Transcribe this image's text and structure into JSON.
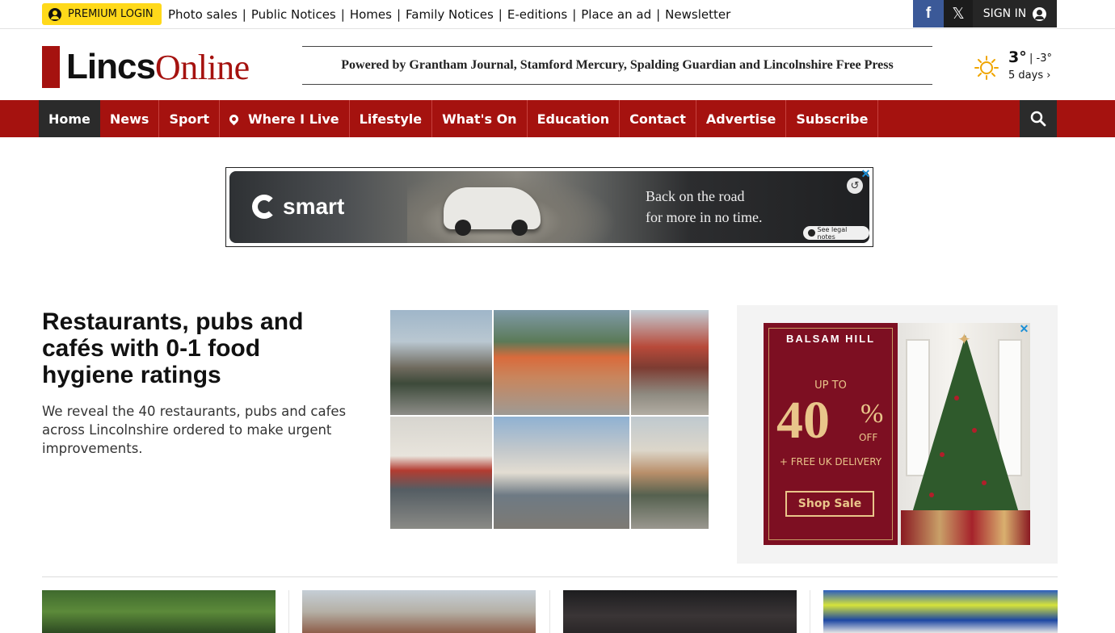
{
  "topbar": {
    "premium_label": "PREMIUM LOGIN",
    "links": [
      "Photo sales",
      "Public Notices",
      "Homes",
      "Family Notices",
      "E-editions",
      "Place an ad",
      "Newsletter"
    ],
    "facebook_glyph": "f",
    "x_glyph": "𝕏",
    "signin_label": "SIGN IN"
  },
  "masthead": {
    "logo_part1": "Lincs",
    "logo_part2": "Online",
    "powered_by": "Powered by Grantham Journal, Stamford Mercury, Spalding Guardian and Lincolnshire Free Press",
    "brand_color": "#a5120f"
  },
  "weather": {
    "temp_high": "3°",
    "temp_low": "| -3°",
    "forecast_link": "5 days ›",
    "icon": "sun-icon"
  },
  "nav": {
    "items": [
      "Home",
      "News",
      "Sport",
      "Where I Live",
      "Lifestyle",
      "What's On",
      "Education",
      "Contact",
      "Advertise",
      "Subscribe"
    ],
    "active": "Home"
  },
  "banner_ad": {
    "brand": "smart",
    "line1": "Back on the road",
    "line2": "for more in no time.",
    "legal": "See legal notes",
    "close_glyph": "✕",
    "replay_glyph": "↺"
  },
  "lead_story": {
    "headline": "Restaurants, pubs and cafés with 0-1 food hygiene ratings",
    "standfirst": "We reveal the 40 restaurants, pubs and cafes across Lincolnshire ordered to make urgent improvements."
  },
  "side_ad": {
    "brand": "BALSAM HILL",
    "up_to": "UP TO",
    "amount": "40",
    "percent": "%",
    "off": "OFF",
    "delivery": "+ FREE UK DELIVERY",
    "cta": "Shop Sale",
    "close_glyph": "✕"
  }
}
